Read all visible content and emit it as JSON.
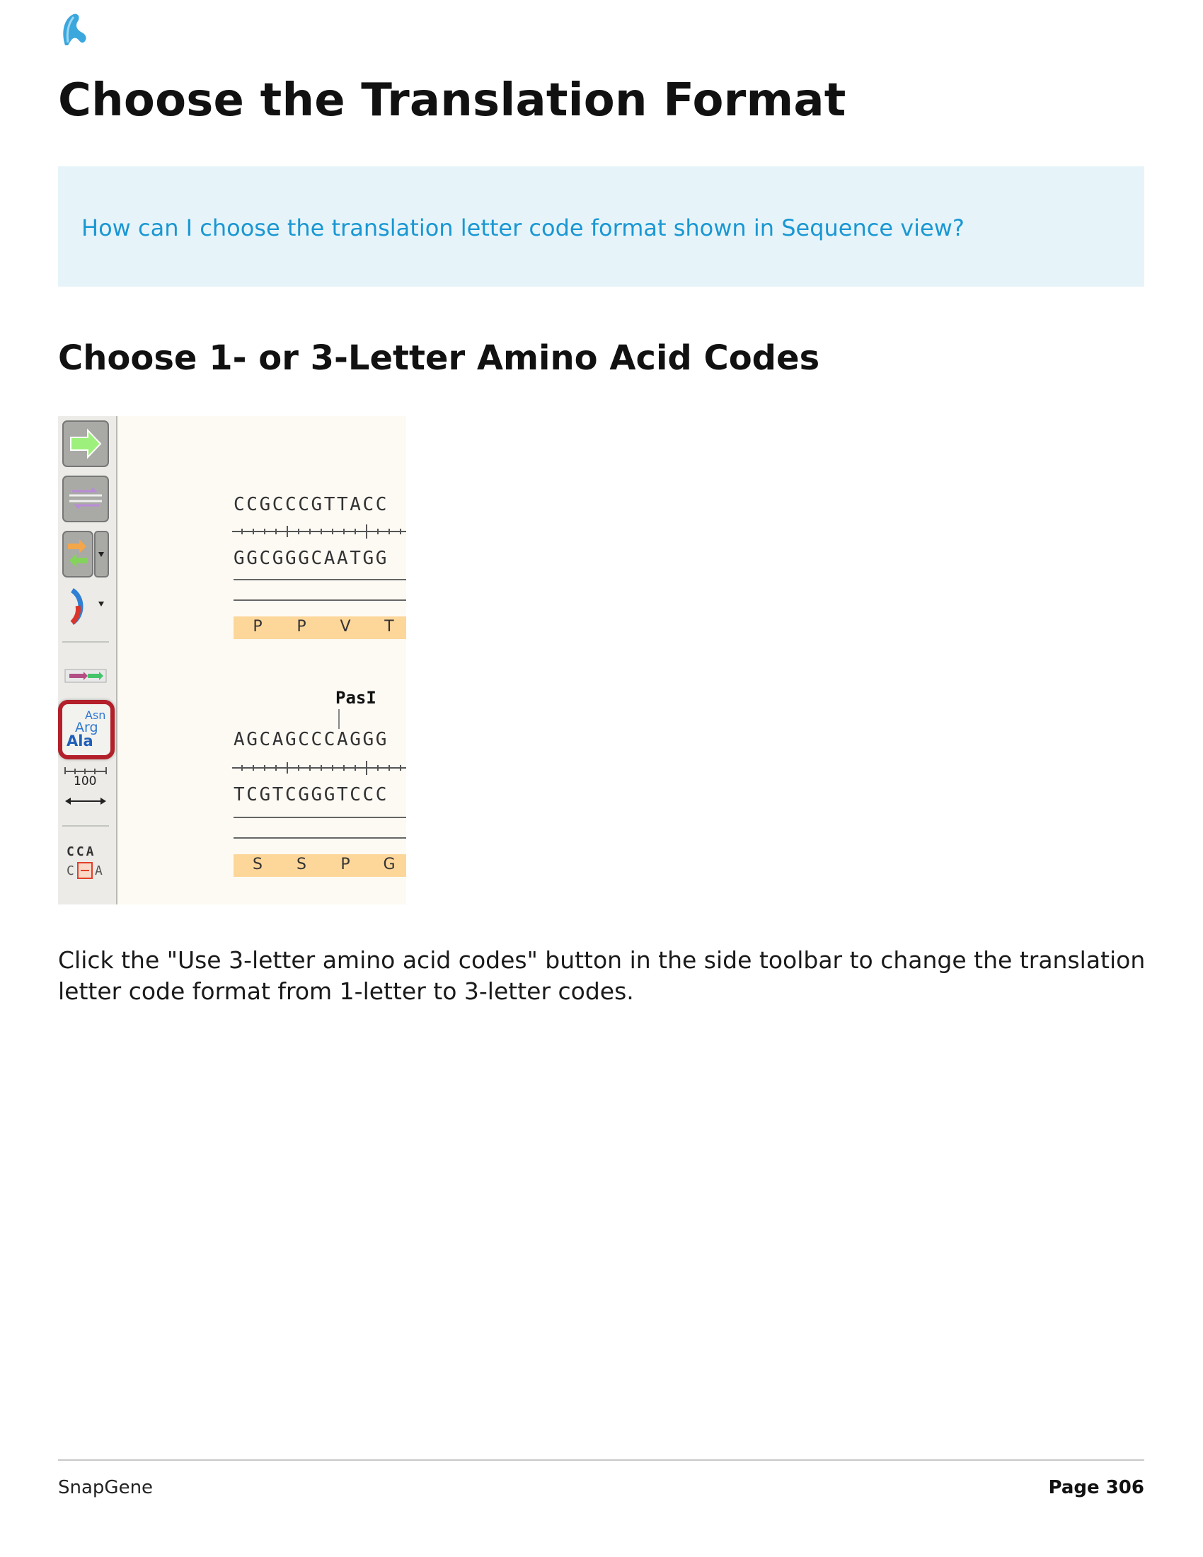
{
  "page": {
    "title": "Choose the Translation Format",
    "callout_question": "How can I choose the translation letter code format shown in Sequence view?",
    "section_heading": "Choose 1- or 3-Letter Amino Acid Codes",
    "description": "Click the \"Use 3-letter amino acid codes\" button in the side toolbar to change the translation letter code format from 1-letter to 3-letter codes."
  },
  "screenshot": {
    "block1": {
      "top_strand": "CCGCCCGTTACC",
      "bottom_strand": "GGCGGGCAATGG",
      "amino_acids": [
        "P",
        "P",
        "V",
        "T"
      ]
    },
    "block2": {
      "enzyme": "PasI",
      "top_strand": "AGCAGCCCAGGG",
      "bottom_strand": "TCGTCGGGTCCC",
      "amino_acids": [
        "S",
        "S",
        "P",
        "G"
      ]
    },
    "toolbar": {
      "aa_code_lines": [
        "Asn",
        "Arg",
        "Ala"
      ],
      "scale_label": "100",
      "mismatch_top": "CCA",
      "mismatch_bottom_left": "C",
      "mismatch_bottom_right": "A"
    },
    "colors": {
      "translation_bar": "#fdd69a",
      "highlight_ring": "#b3202a",
      "callout_bg": "#e6f4fa",
      "callout_text": "#1a97d2"
    }
  },
  "footer": {
    "brand": "SnapGene",
    "page_label": "Page 306"
  }
}
